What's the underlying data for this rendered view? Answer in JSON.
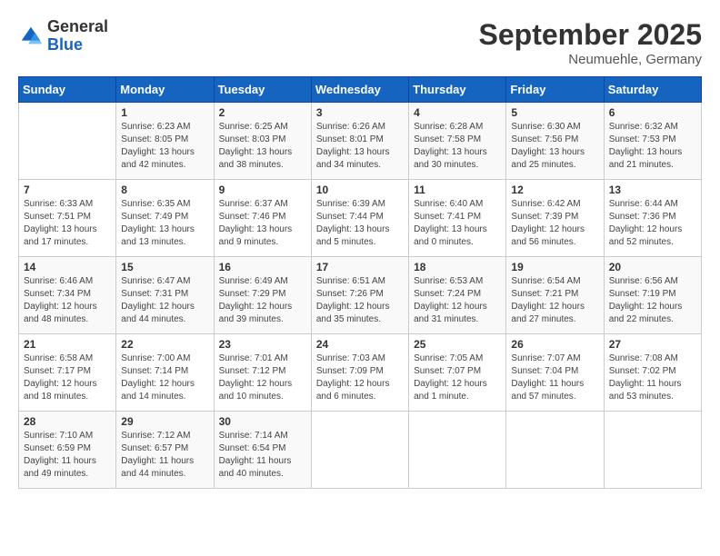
{
  "header": {
    "logo_line1": "General",
    "logo_line2": "Blue",
    "month": "September 2025",
    "location": "Neumuehle, Germany"
  },
  "days_of_week": [
    "Sunday",
    "Monday",
    "Tuesday",
    "Wednesday",
    "Thursday",
    "Friday",
    "Saturday"
  ],
  "weeks": [
    [
      {
        "day": "",
        "info": ""
      },
      {
        "day": "1",
        "info": "Sunrise: 6:23 AM\nSunset: 8:05 PM\nDaylight: 13 hours\nand 42 minutes."
      },
      {
        "day": "2",
        "info": "Sunrise: 6:25 AM\nSunset: 8:03 PM\nDaylight: 13 hours\nand 38 minutes."
      },
      {
        "day": "3",
        "info": "Sunrise: 6:26 AM\nSunset: 8:01 PM\nDaylight: 13 hours\nand 34 minutes."
      },
      {
        "day": "4",
        "info": "Sunrise: 6:28 AM\nSunset: 7:58 PM\nDaylight: 13 hours\nand 30 minutes."
      },
      {
        "day": "5",
        "info": "Sunrise: 6:30 AM\nSunset: 7:56 PM\nDaylight: 13 hours\nand 25 minutes."
      },
      {
        "day": "6",
        "info": "Sunrise: 6:32 AM\nSunset: 7:53 PM\nDaylight: 13 hours\nand 21 minutes."
      }
    ],
    [
      {
        "day": "7",
        "info": "Sunrise: 6:33 AM\nSunset: 7:51 PM\nDaylight: 13 hours\nand 17 minutes."
      },
      {
        "day": "8",
        "info": "Sunrise: 6:35 AM\nSunset: 7:49 PM\nDaylight: 13 hours\nand 13 minutes."
      },
      {
        "day": "9",
        "info": "Sunrise: 6:37 AM\nSunset: 7:46 PM\nDaylight: 13 hours\nand 9 minutes."
      },
      {
        "day": "10",
        "info": "Sunrise: 6:39 AM\nSunset: 7:44 PM\nDaylight: 13 hours\nand 5 minutes."
      },
      {
        "day": "11",
        "info": "Sunrise: 6:40 AM\nSunset: 7:41 PM\nDaylight: 13 hours\nand 0 minutes."
      },
      {
        "day": "12",
        "info": "Sunrise: 6:42 AM\nSunset: 7:39 PM\nDaylight: 12 hours\nand 56 minutes."
      },
      {
        "day": "13",
        "info": "Sunrise: 6:44 AM\nSunset: 7:36 PM\nDaylight: 12 hours\nand 52 minutes."
      }
    ],
    [
      {
        "day": "14",
        "info": "Sunrise: 6:46 AM\nSunset: 7:34 PM\nDaylight: 12 hours\nand 48 minutes."
      },
      {
        "day": "15",
        "info": "Sunrise: 6:47 AM\nSunset: 7:31 PM\nDaylight: 12 hours\nand 44 minutes."
      },
      {
        "day": "16",
        "info": "Sunrise: 6:49 AM\nSunset: 7:29 PM\nDaylight: 12 hours\nand 39 minutes."
      },
      {
        "day": "17",
        "info": "Sunrise: 6:51 AM\nSunset: 7:26 PM\nDaylight: 12 hours\nand 35 minutes."
      },
      {
        "day": "18",
        "info": "Sunrise: 6:53 AM\nSunset: 7:24 PM\nDaylight: 12 hours\nand 31 minutes."
      },
      {
        "day": "19",
        "info": "Sunrise: 6:54 AM\nSunset: 7:21 PM\nDaylight: 12 hours\nand 27 minutes."
      },
      {
        "day": "20",
        "info": "Sunrise: 6:56 AM\nSunset: 7:19 PM\nDaylight: 12 hours\nand 22 minutes."
      }
    ],
    [
      {
        "day": "21",
        "info": "Sunrise: 6:58 AM\nSunset: 7:17 PM\nDaylight: 12 hours\nand 18 minutes."
      },
      {
        "day": "22",
        "info": "Sunrise: 7:00 AM\nSunset: 7:14 PM\nDaylight: 12 hours\nand 14 minutes."
      },
      {
        "day": "23",
        "info": "Sunrise: 7:01 AM\nSunset: 7:12 PM\nDaylight: 12 hours\nand 10 minutes."
      },
      {
        "day": "24",
        "info": "Sunrise: 7:03 AM\nSunset: 7:09 PM\nDaylight: 12 hours\nand 6 minutes."
      },
      {
        "day": "25",
        "info": "Sunrise: 7:05 AM\nSunset: 7:07 PM\nDaylight: 12 hours\nand 1 minute."
      },
      {
        "day": "26",
        "info": "Sunrise: 7:07 AM\nSunset: 7:04 PM\nDaylight: 11 hours\nand 57 minutes."
      },
      {
        "day": "27",
        "info": "Sunrise: 7:08 AM\nSunset: 7:02 PM\nDaylight: 11 hours\nand 53 minutes."
      }
    ],
    [
      {
        "day": "28",
        "info": "Sunrise: 7:10 AM\nSunset: 6:59 PM\nDaylight: 11 hours\nand 49 minutes."
      },
      {
        "day": "29",
        "info": "Sunrise: 7:12 AM\nSunset: 6:57 PM\nDaylight: 11 hours\nand 44 minutes."
      },
      {
        "day": "30",
        "info": "Sunrise: 7:14 AM\nSunset: 6:54 PM\nDaylight: 11 hours\nand 40 minutes."
      },
      {
        "day": "",
        "info": ""
      },
      {
        "day": "",
        "info": ""
      },
      {
        "day": "",
        "info": ""
      },
      {
        "day": "",
        "info": ""
      }
    ]
  ]
}
